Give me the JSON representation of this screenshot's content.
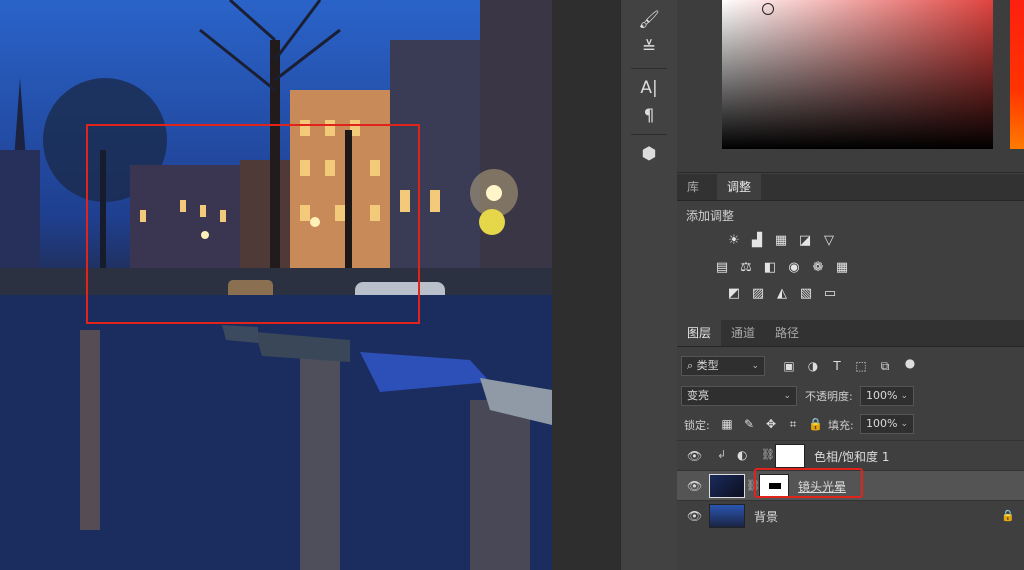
{
  "panels": {
    "library_tab": "库",
    "adjustments_tab": "调整",
    "add_adjustment_label": "添加调整",
    "layers_tab": "图层",
    "channels_tab": "通道",
    "paths_tab": "路径"
  },
  "tools": {
    "type_tool_label": "A|",
    "paragraph_label": "¶"
  },
  "layers_panel": {
    "filter_kind": "类型",
    "blend_mode": "变亮",
    "opacity_label": "不透明度:",
    "opacity_value": "100%",
    "lock_label": "锁定:",
    "fill_label": "填充:",
    "fill_value": "100%",
    "layers": [
      {
        "name": "色相/饱和度 1",
        "visible": true,
        "type": "adjustment"
      },
      {
        "name": "镜头光晕",
        "visible": true,
        "type": "smart-object-masked",
        "selected": true
      },
      {
        "name": "背景",
        "visible": true,
        "type": "background",
        "locked": true
      }
    ]
  },
  "colors": {
    "highlight_red": "#e0241c",
    "panel_bg": "#3f3f3f",
    "selected_row": "#545454"
  }
}
